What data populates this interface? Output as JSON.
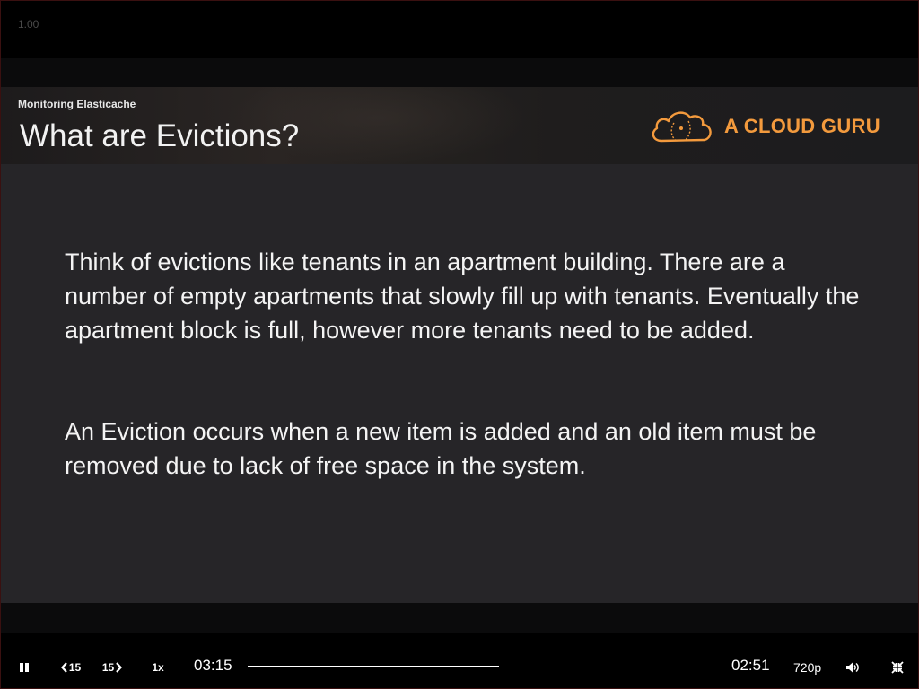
{
  "player": {
    "rate_indicator": "1.00"
  },
  "slide": {
    "course": "Monitoring Elasticache",
    "title": "What are Evictions?",
    "brand": {
      "name": "A CLOUD GURU",
      "color": "#f39a3d"
    },
    "paragraphs": [
      "Think of evictions like tenants in an apartment building. There are a number of empty apartments that slowly fill up with tenants. Eventually the apartment block is full, however more tenants need to be added.",
      "An Eviction occurs when a new item is added and an old item must be removed due to lack of free space in the system."
    ]
  },
  "controls": {
    "play_state_icon": "pause-icon",
    "rewind_label": "15",
    "forward_label": "15",
    "speed_label": "1x",
    "elapsed": "03:15",
    "remaining": "02:51",
    "quality": "720p",
    "volume_icon": "volume-icon",
    "fullscreen_icon": "exit-fullscreen-icon"
  }
}
